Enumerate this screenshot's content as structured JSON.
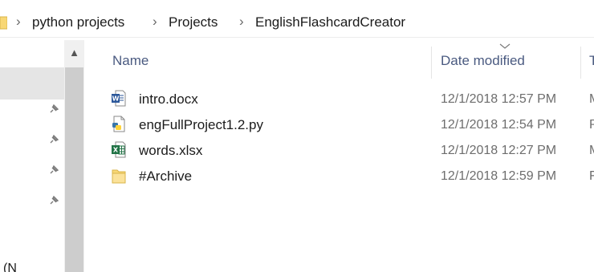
{
  "breadcrumb": {
    "items": [
      {
        "label": "python projects"
      },
      {
        "label": "Projects"
      },
      {
        "label": "EnglishFlashcardCreator"
      }
    ],
    "separator": "›"
  },
  "columns": {
    "name": "Name",
    "date_modified": "Date modified",
    "type_truncated": "T"
  },
  "files": [
    {
      "name": "intro.docx",
      "date": "12/1/2018 12:57 PM",
      "type_truncated": "M",
      "icon": "word-document-icon"
    },
    {
      "name": "engFullProject1.2.py",
      "date": "12/1/2018 12:54 PM",
      "type_truncated": "P",
      "icon": "python-file-icon"
    },
    {
      "name": "words.xlsx",
      "date": "12/1/2018 12:27 PM",
      "type_truncated": "M",
      "icon": "excel-workbook-icon"
    },
    {
      "name": "#Archive",
      "date": "12/1/2018 12:59 PM",
      "type_truncated": "F",
      "icon": "folder-icon"
    }
  ],
  "navpane": {
    "truncated_label": "(N",
    "pins": [
      "pin-icon",
      "pin-icon",
      "pin-icon",
      "pin-icon"
    ]
  },
  "colors": {
    "folder": "#f8d775",
    "word": "#2b579a",
    "excel": "#217346",
    "header_text": "#4a5a80"
  }
}
